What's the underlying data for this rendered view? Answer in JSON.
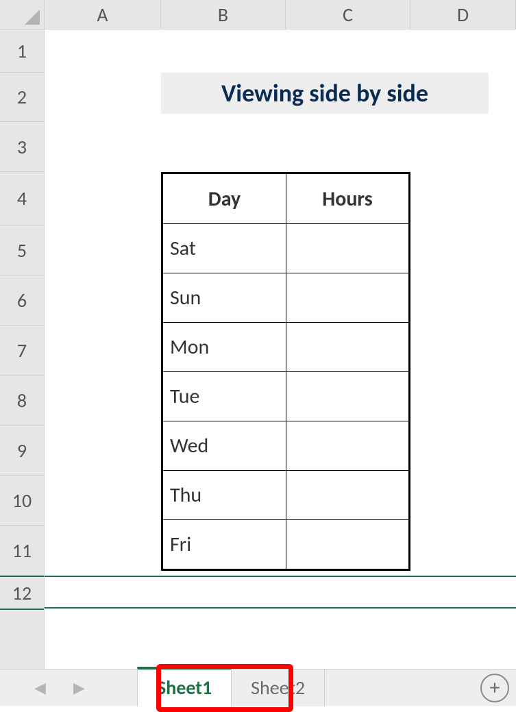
{
  "columns": [
    {
      "label": "A",
      "width": 170
    },
    {
      "label": "B",
      "width": 182
    },
    {
      "label": "C",
      "width": 182
    },
    {
      "label": "D",
      "width": 154
    }
  ],
  "rows": [
    {
      "num": "1",
      "height": 63
    },
    {
      "num": "2",
      "height": 72
    },
    {
      "num": "3",
      "height": 73
    },
    {
      "num": "4",
      "height": 78
    },
    {
      "num": "5",
      "height": 73
    },
    {
      "num": "6",
      "height": 73
    },
    {
      "num": "7",
      "height": 73
    },
    {
      "num": "8",
      "height": 73
    },
    {
      "num": "9",
      "height": 73
    },
    {
      "num": "10",
      "height": 73
    },
    {
      "num": "11",
      "height": 73
    },
    {
      "num": "12",
      "height": 50
    }
  ],
  "selected_row_index": 11,
  "title": {
    "text": "Viewing side by side",
    "col_start": 1,
    "col_span": 3,
    "row": 1
  },
  "table": {
    "col_start": 1,
    "row_start": 3,
    "head": [
      "Day",
      "Hours"
    ],
    "body": [
      [
        "Sat",
        ""
      ],
      [
        "Sun",
        ""
      ],
      [
        "Mon",
        ""
      ],
      [
        "Tue",
        ""
      ],
      [
        "Wed",
        ""
      ],
      [
        "Thu",
        ""
      ],
      [
        "Fri",
        ""
      ]
    ]
  },
  "tabs": {
    "active": "Sheet1",
    "list": [
      "Sheet1",
      "Sheet2"
    ]
  },
  "nav": {
    "prev": "◀",
    "next": "▶"
  },
  "new_sheet_glyph": "+"
}
